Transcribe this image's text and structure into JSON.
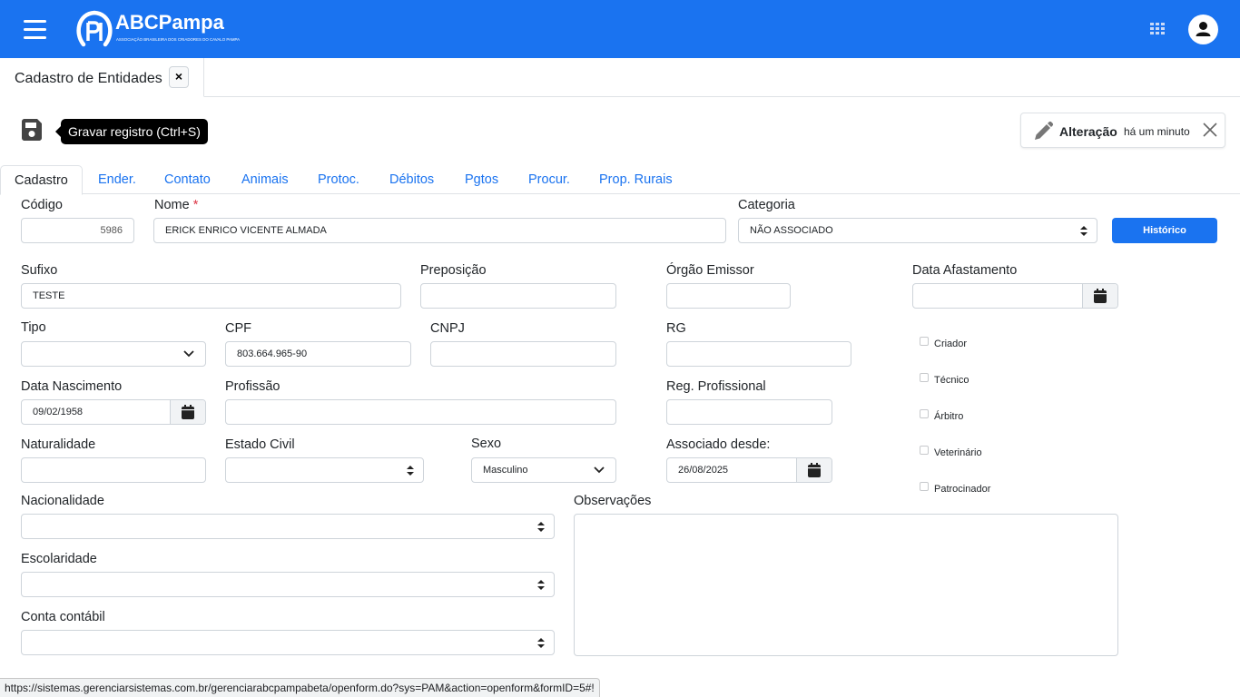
{
  "app": {
    "brand": "ABCPampa",
    "brand_subtitle": "ASSOCIAÇÃO BRASILEIRA DOS CRIADORES DO CAVALO PAMPA",
    "accent_color": "#1a73f0"
  },
  "header": {
    "menu_icon": "hamburger-icon",
    "apps_icon": "grid-icon",
    "user_icon": "user-avatar-icon"
  },
  "doc_tab": {
    "label": "Cadastro de Entidades",
    "close": "×"
  },
  "toolbar": {
    "save_icon": "floppy-disk-icon",
    "save_tooltip": "Gravar registro (Ctrl+S)"
  },
  "status": {
    "title": "Alteração",
    "time": "há um minuto",
    "icon": "pencil-icon"
  },
  "tabs": [
    {
      "label": "Cadastro",
      "active": true
    },
    {
      "label": "Ender."
    },
    {
      "label": "Contato"
    },
    {
      "label": "Animais"
    },
    {
      "label": "Protoc."
    },
    {
      "label": "Débitos"
    },
    {
      "label": "Pgtos"
    },
    {
      "label": "Procur."
    },
    {
      "label": "Prop. Rurais"
    }
  ],
  "form": {
    "codigo": {
      "label": "Código",
      "value": "5986"
    },
    "nome": {
      "label": "Nome",
      "required_mark": "*",
      "value": "ERICK ENRICO VICENTE ALMADA"
    },
    "categoria": {
      "label": "Categoria",
      "value": "NÃO ASSOCIADO"
    },
    "historico_button": "Histórico",
    "sufixo": {
      "label": "Sufixo",
      "value": "TESTE"
    },
    "preposicao": {
      "label": "Preposição",
      "value": ""
    },
    "orgao_emissor": {
      "label": "Órgão Emissor",
      "value": ""
    },
    "data_afastamento": {
      "label": "Data Afastamento",
      "value": ""
    },
    "tipo": {
      "label": "Tipo",
      "value": ""
    },
    "cpf": {
      "label": "CPF",
      "value": "803.664.965-90"
    },
    "cnpj": {
      "label": "CNPJ",
      "value": ""
    },
    "rg": {
      "label": "RG",
      "value": ""
    },
    "data_nascimento": {
      "label": "Data Nascimento",
      "value": "09/02/1958"
    },
    "profissao": {
      "label": "Profissão",
      "value": ""
    },
    "reg_profissional": {
      "label": "Reg. Profissional",
      "value": ""
    },
    "naturalidade": {
      "label": "Naturalidade",
      "value": ""
    },
    "estado_civil": {
      "label": "Estado Civil",
      "value": ""
    },
    "sexo": {
      "label": "Sexo",
      "value": "Masculino"
    },
    "associado_desde": {
      "label": "Associado desde:",
      "value": "26/08/2025"
    },
    "nacionalidade": {
      "label": "Nacionalidade",
      "value": ""
    },
    "escolaridade": {
      "label": "Escolaridade",
      "value": ""
    },
    "conta_contabil": {
      "label": "Conta contábil",
      "value": ""
    },
    "observacoes": {
      "label": "Observações",
      "value": ""
    },
    "checkboxes": [
      {
        "label": "Criador",
        "checked": false
      },
      {
        "label": "Técnico",
        "checked": false
      },
      {
        "label": "Árbitro",
        "checked": false
      },
      {
        "label": "Veterinário",
        "checked": false
      },
      {
        "label": "Patrocinador",
        "checked": false
      }
    ]
  },
  "status_url": "https://sistemas.gerenciarsistemas.com.br/gerenciarabcpampabeta/openform.do?sys=PAM&action=openform&formID=5#!"
}
